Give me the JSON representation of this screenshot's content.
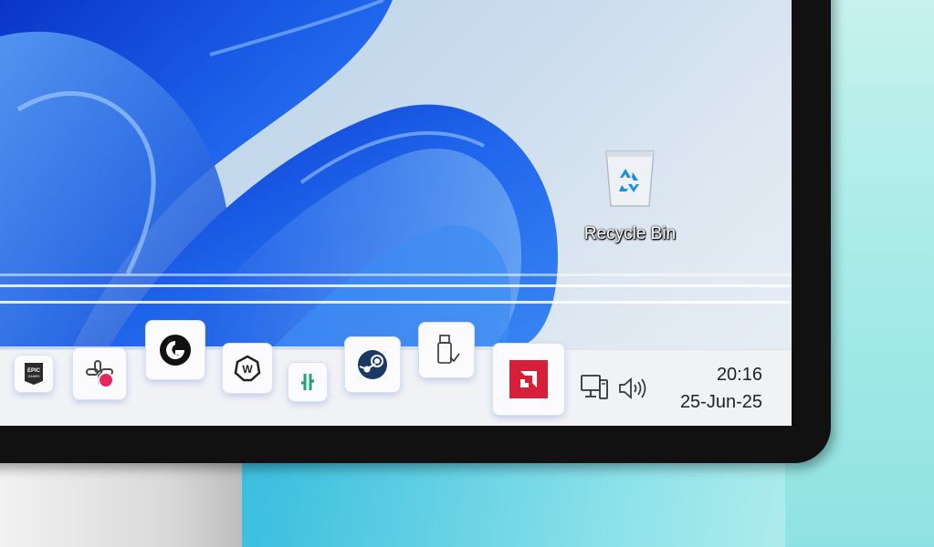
{
  "desktop": {
    "recycle_bin_label": "Recycle Bin"
  },
  "taskbar": {
    "apps": [
      {
        "name": "epic-games",
        "label": "EPIC GAMES"
      },
      {
        "name": "slack"
      },
      {
        "name": "logitech-g-hub"
      },
      {
        "name": "wootility"
      },
      {
        "name": "app-green"
      },
      {
        "name": "steam"
      },
      {
        "name": "usb-safely-remove"
      },
      {
        "name": "amd-software"
      }
    ],
    "tray": {
      "network_icon": "network-icon",
      "volume_icon": "volume-icon"
    },
    "clock": {
      "time": "20:16",
      "date": "25-Jun-25"
    }
  },
  "colors": {
    "wallpaper_blue": "#1e5fe0",
    "amd_red": "#d5203a",
    "taskbar_bg": "#f1f2f5"
  }
}
